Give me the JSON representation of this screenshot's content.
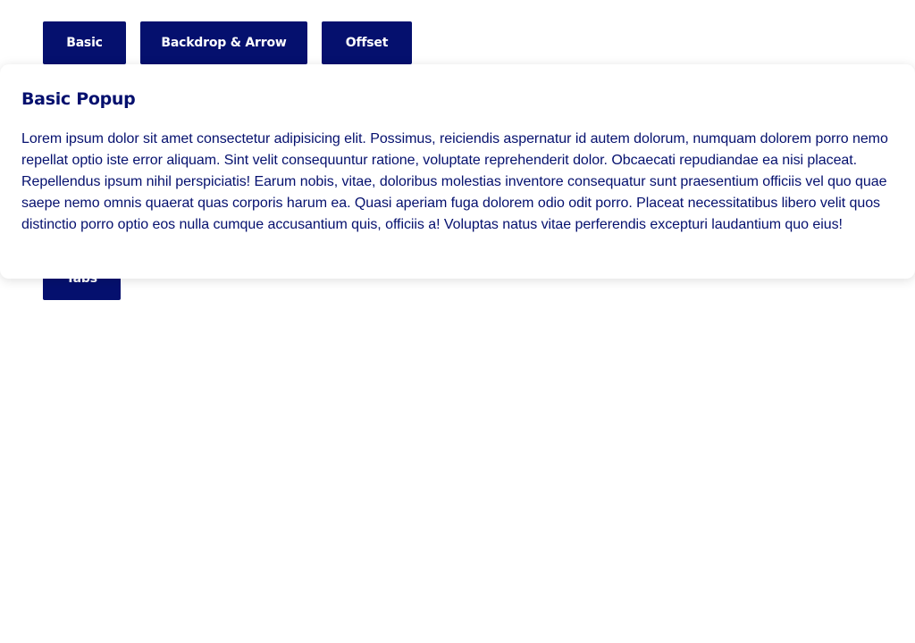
{
  "toolbar": {
    "buttons": [
      {
        "label": "Basic"
      },
      {
        "label": "Backdrop & Arrow"
      },
      {
        "label": "Offset"
      },
      {
        "label": "Tabs"
      }
    ]
  },
  "popup": {
    "title": "Basic Popup",
    "body": "Lorem ipsum dolor sit amet consectetur adipisicing elit. Possimus, reiciendis aspernatur id autem dolorum, numquam dolorem porro nemo repellat optio iste error aliquam. Sint velit consequuntur ratione, voluptate reprehenderit dolor. Obcaecati repudiandae ea nisi placeat. Repellendus ipsum nihil perspiciatis! Earum nobis, vitae, doloribus molestias inventore consequatur sunt praesentium officiis vel quo quae saepe nemo omnis quaerat quas corporis harum ea. Quasi aperiam fuga dolorem odio odit porro. Placeat necessitatibus libero velit quos distinctio porro optio eos nulla cumque accusantium quis, officiis a! Voluptas natus vitae perferendis excepturi laudantium quo eius!"
  },
  "colors": {
    "primary": "#05106e",
    "background": "#ffffff"
  }
}
